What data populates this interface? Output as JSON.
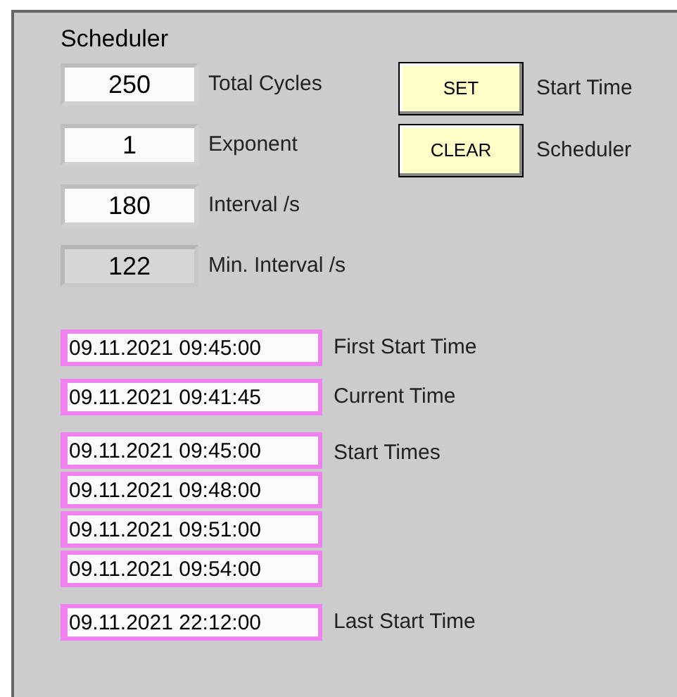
{
  "title": "Scheduler",
  "numeric_fields": [
    {
      "value": "250",
      "label": "Total Cycles",
      "disabled": false
    },
    {
      "value": "1",
      "label": "Exponent",
      "disabled": false
    },
    {
      "value": "180",
      "label": "Interval /s",
      "disabled": false
    },
    {
      "value": "122",
      "label": "Min. Interval /s",
      "disabled": true
    }
  ],
  "buttons": [
    {
      "label": "SET",
      "caption": "Start Time"
    },
    {
      "label": "CLEAR",
      "caption": "Scheduler"
    }
  ],
  "first_start_time": {
    "value": "09.11.2021 09:45:00",
    "label": "First Start Time"
  },
  "current_time": {
    "value": "09.11.2021 09:41:45",
    "label": "Current Time"
  },
  "start_times": {
    "label": "Start Times",
    "values": [
      "09.11.2021 09:45:00",
      "09.11.2021 09:48:00",
      "09.11.2021 09:51:00",
      "09.11.2021 09:54:00"
    ]
  },
  "last_start_time": {
    "value": "09.11.2021 22:12:00",
    "label": "Last Start Time"
  }
}
